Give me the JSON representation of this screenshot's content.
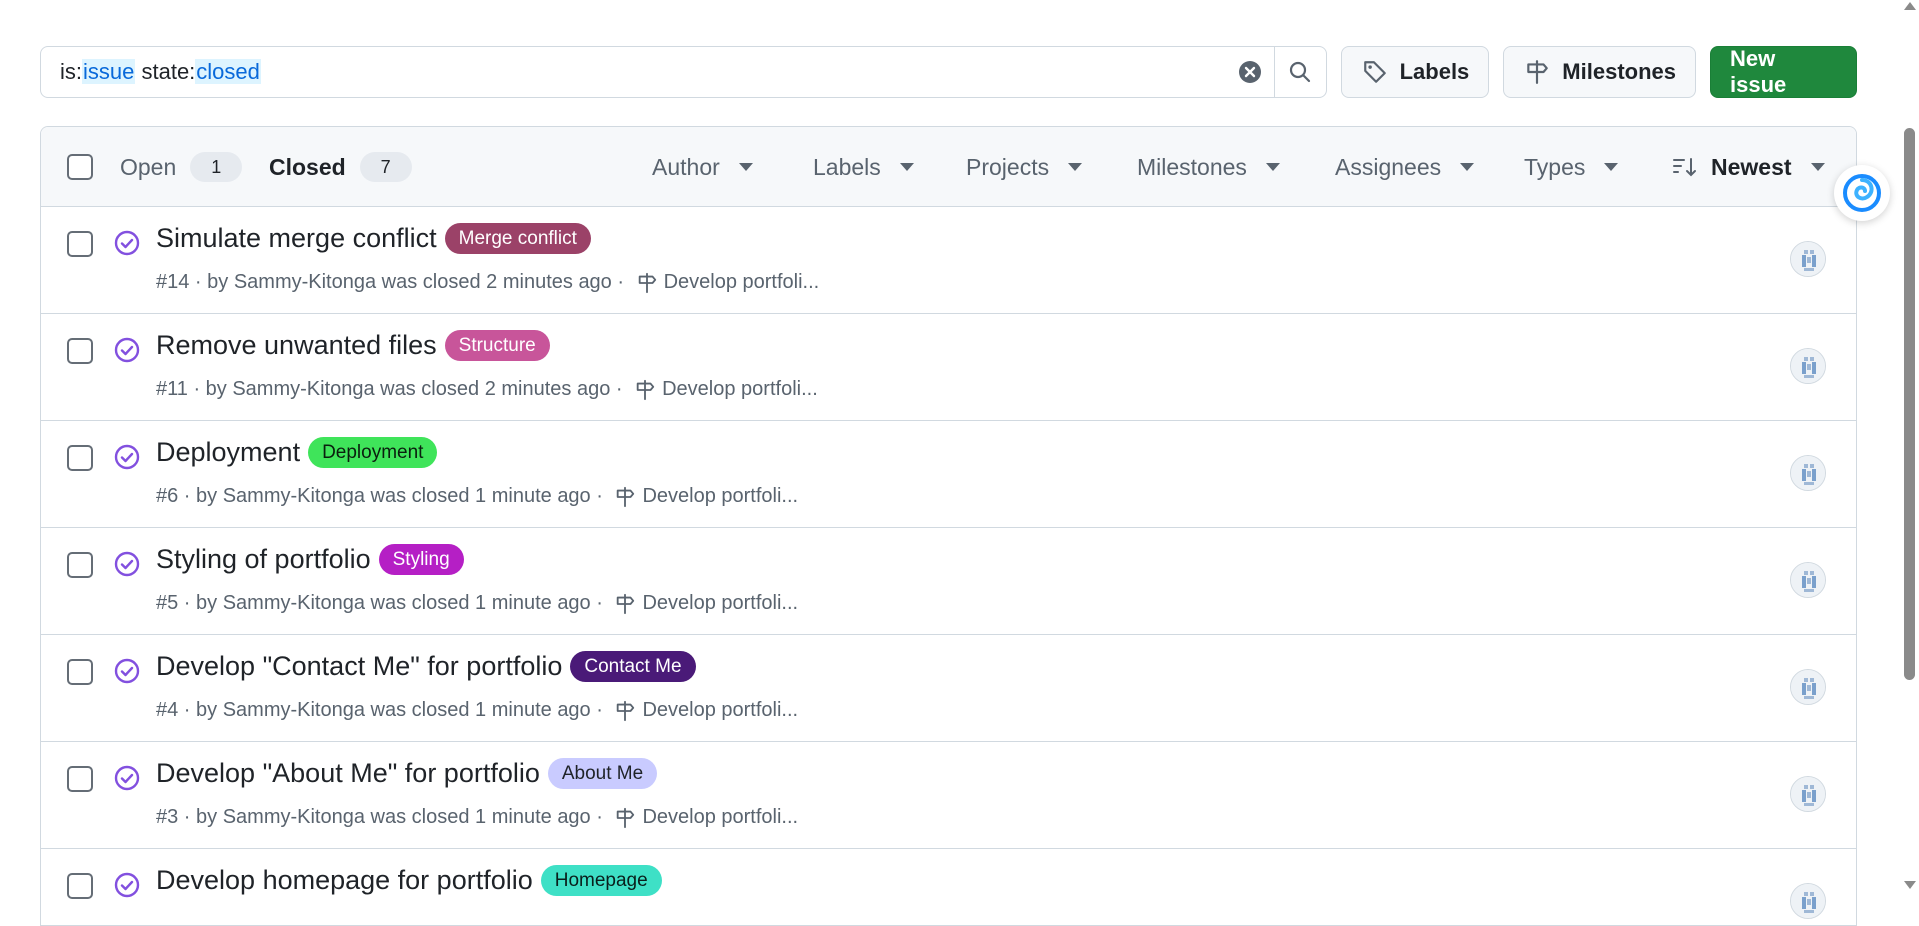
{
  "search": {
    "q_is_key": "is:",
    "q_is_val": "issue",
    "q_space": " ",
    "q_state_key": "state:",
    "q_state_val": "closed"
  },
  "toolbar": {
    "labels": "Labels",
    "milestones": "Milestones",
    "new_issue": "New issue"
  },
  "header": {
    "open_label": "Open",
    "open_count": "1",
    "closed_label": "Closed",
    "closed_count": "7",
    "filters": {
      "author": "Author",
      "labels": "Labels",
      "projects": "Projects",
      "milestones": "Milestones",
      "assignees": "Assignees",
      "types": "Types",
      "sort": "Newest"
    }
  },
  "issues": [
    {
      "title": "Simulate merge conflict",
      "label": "Merge conflict",
      "label_bg": "#9b4268",
      "label_fg": "#ffffff",
      "number": "#14",
      "author": "Sammy-Kitonga",
      "closed": "2 minutes ago",
      "milestone": "Develop portfoli..."
    },
    {
      "title": "Remove unwanted files",
      "label": "Structure",
      "label_bg": "#c8559a",
      "label_fg": "#ffffff",
      "number": "#11",
      "author": "Sammy-Kitonga",
      "closed": "2 minutes ago",
      "milestone": "Develop portfoli..."
    },
    {
      "title": "Deployment",
      "label": "Deployment",
      "label_bg": "#3fe45a",
      "label_fg": "#0a1f0e",
      "number": "#6",
      "author": "Sammy-Kitonga",
      "closed": "1 minute ago",
      "milestone": "Develop portfoli..."
    },
    {
      "title": "Styling of portfolio",
      "label": "Styling",
      "label_bg": "#b51fc5",
      "label_fg": "#ffffff",
      "number": "#5",
      "author": "Sammy-Kitonga",
      "closed": "1 minute ago",
      "milestone": "Develop portfoli..."
    },
    {
      "title": "Develop \"Contact Me\" for portfolio",
      "label": "Contact Me",
      "label_bg": "#4a1a78",
      "label_fg": "#ffffff",
      "number": "#4",
      "author": "Sammy-Kitonga",
      "closed": "1 minute ago",
      "milestone": "Develop portfoli..."
    },
    {
      "title": "Develop \"About Me\" for portfolio",
      "label": "About Me",
      "label_bg": "#c9cbff",
      "label_fg": "#1f2328",
      "number": "#3",
      "author": "Sammy-Kitonga",
      "closed": "1 minute ago",
      "milestone": "Develop portfoli..."
    },
    {
      "title": "Develop homepage for portfolio",
      "label": "Homepage",
      "label_bg": "#3ee0c6",
      "label_fg": "#0a1f1c",
      "number": "",
      "author": "",
      "closed": "",
      "milestone": ""
    }
  ],
  "meta_text": {
    "by": " · by ",
    "was_closed": " was closed ",
    "sep": " · "
  },
  "colors": {
    "primary_green": "#1f883d",
    "closed_purple": "#8250df",
    "link_blue": "#0969da"
  }
}
